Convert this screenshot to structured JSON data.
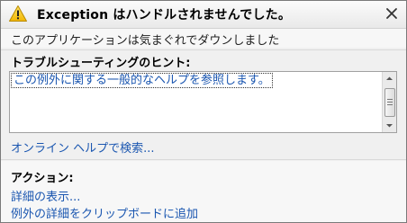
{
  "dialog": {
    "title": "Exception はハンドルされませんでした。",
    "message": "このアプリケーションは気まぐれでダウンしました",
    "icons": {
      "header": "warning-icon",
      "close": "close-icon"
    }
  },
  "troubleshooting": {
    "heading": "トラブルシューティングのヒント:",
    "items": [
      "この例外に関する一般的なヘルプを参照します。"
    ],
    "online_help_link": "オンライン ヘルプで検索..."
  },
  "actions": {
    "heading": "アクション:",
    "view_details": "詳細の表示...",
    "copy_details": "例外の詳細をクリップボードに追加"
  },
  "colors": {
    "link": "#1a56b0",
    "warning": "#f5c400"
  }
}
